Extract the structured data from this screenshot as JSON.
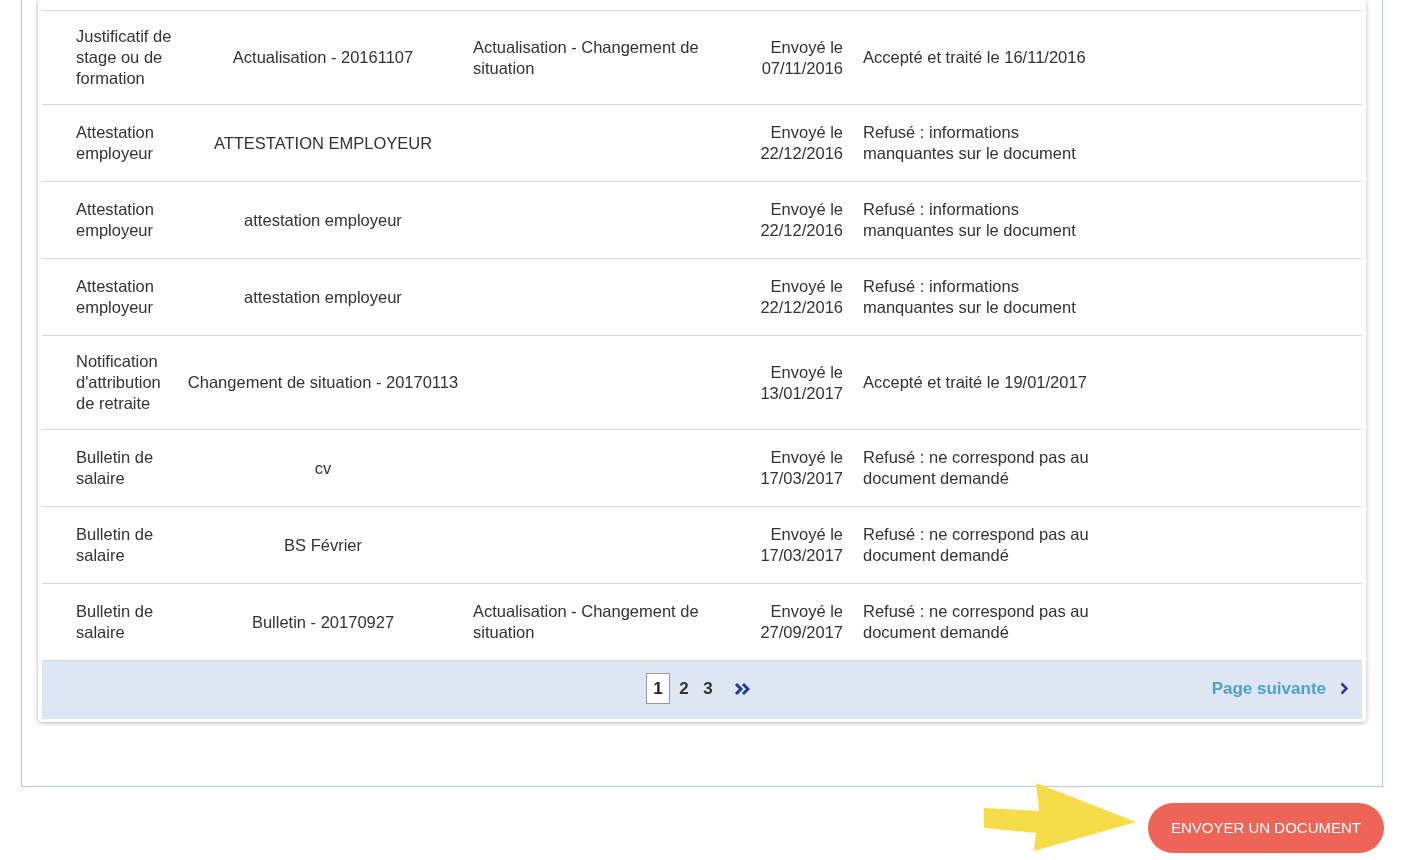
{
  "table": {
    "rows": [
      {
        "type": "Justificatif de stage ou de formation",
        "name": "Actualisation - 20161107",
        "context": "Actualisation - Changement de situation",
        "sent": "Envoyé le 07/11/2016",
        "status": "Accepté et traité le 16/11/2016"
      },
      {
        "type": "Attestation employeur",
        "name": "ATTESTATION EMPLOYEUR",
        "context": "",
        "sent": "Envoyé le 22/12/2016",
        "status": "Refusé : informations manquantes sur le document"
      },
      {
        "type": "Attestation employeur",
        "name": "attestation employeur",
        "context": "",
        "sent": "Envoyé le 22/12/2016",
        "status": "Refusé : informations manquantes sur le document"
      },
      {
        "type": "Attestation employeur",
        "name": "attestation employeur",
        "context": "",
        "sent": "Envoyé le 22/12/2016",
        "status": "Refusé : informations manquantes sur le document"
      },
      {
        "type": "Notification d'attribution de retraite",
        "name": "Changement de situation - 20170113",
        "context": "",
        "sent": "Envoyé le 13/01/2017",
        "status": "Accepté et traité le 19/01/2017"
      },
      {
        "type": "Bulletin de salaire",
        "name": "cv",
        "context": "",
        "sent": "Envoyé le 17/03/2017",
        "status": "Refusé : ne correspond pas au document demandé"
      },
      {
        "type": "Bulletin de salaire",
        "name": "BS Février",
        "context": "",
        "sent": "Envoyé le 17/03/2017",
        "status": "Refusé : ne correspond pas au document demandé"
      },
      {
        "type": "Bulletin de salaire",
        "name": "Bulletin - 20170927",
        "context": "Actualisation - Changement de situation",
        "sent": "Envoyé le 27/09/2017",
        "status": "Refusé : ne correspond pas au document demandé"
      }
    ]
  },
  "pagination": {
    "pages": [
      {
        "label": "1",
        "selected": true
      },
      {
        "label": "2",
        "selected": false
      },
      {
        "label": "3",
        "selected": false
      }
    ],
    "next_page": "Page suivante"
  },
  "send_button": "ENVOYER UN DOCUMENT"
}
